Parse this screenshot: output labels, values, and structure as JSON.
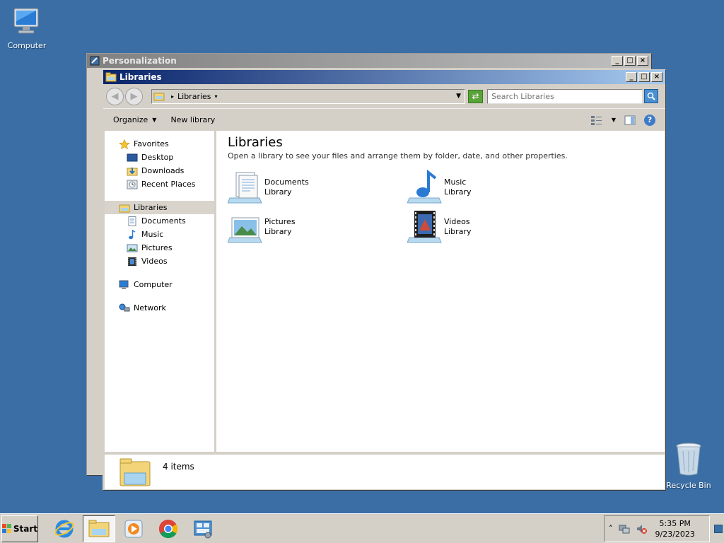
{
  "desktop": {
    "computer_label": "Computer",
    "recycle_label": "Recycle Bin"
  },
  "bg_window": {
    "title": "Personalization"
  },
  "window": {
    "title": "Libraries",
    "btn_min": "_",
    "btn_max": "□",
    "btn_close": "×",
    "address": {
      "segment": "Libraries"
    },
    "search": {
      "placeholder": "Search Libraries"
    },
    "toolbar": {
      "organize": "Organize",
      "new_library": "New library",
      "help": "?"
    },
    "nav": {
      "favorites": {
        "label": "Favorites",
        "items": [
          "Desktop",
          "Downloads",
          "Recent Places"
        ]
      },
      "libraries": {
        "label": "Libraries",
        "items": [
          "Documents",
          "Music",
          "Pictures",
          "Videos"
        ]
      },
      "computer": "Computer",
      "network": "Network"
    },
    "content": {
      "heading": "Libraries",
      "description": "Open a library to see your files and arrange them by folder, date, and other properties.",
      "items": [
        {
          "name": "Documents",
          "type": "Library",
          "icon": "documents-library-icon"
        },
        {
          "name": "Music",
          "type": "Library",
          "icon": "music-library-icon"
        },
        {
          "name": "Pictures",
          "type": "Library",
          "icon": "pictures-library-icon"
        },
        {
          "name": "Videos",
          "type": "Library",
          "icon": "videos-library-icon"
        }
      ]
    },
    "status": {
      "count": "4 items"
    }
  },
  "taskbar": {
    "start_label": "Start",
    "clock": {
      "time": "5:35 PM",
      "date": "9/23/2023"
    },
    "tray_expand": "˄"
  },
  "colors": {
    "desktop": "#3a6ea5",
    "title_active_start": "#0a246a",
    "title_active_end": "#a6caf0",
    "chrome": "#d4d0c8"
  }
}
